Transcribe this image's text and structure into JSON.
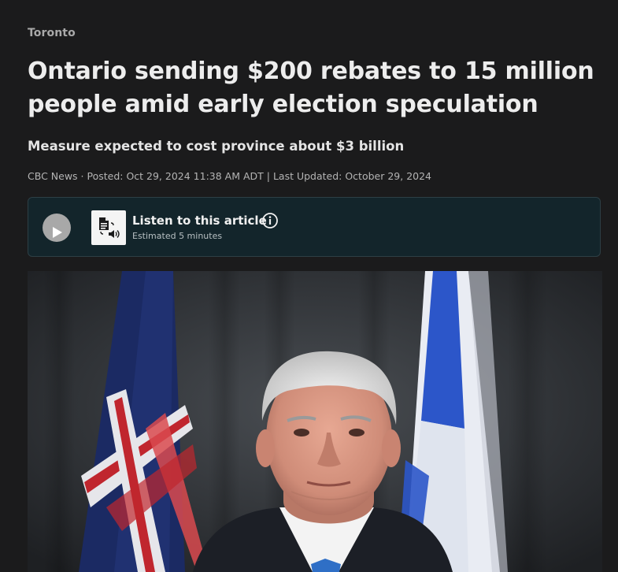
{
  "section": {
    "label": "Toronto"
  },
  "article": {
    "headline": "Ontario sending $200 rebates to 15 million people amid early election speculation",
    "deck": "Measure expected to cost province about $3 billion",
    "byline": "CBC News · Posted: Oct 29, 2024 11:38 AM ADT | Last Updated: October 29, 2024"
  },
  "audio": {
    "title": "Listen to this article",
    "subtitle": "Estimated 5 minutes",
    "play_icon": "play-icon",
    "thumb_icons": [
      "document-icon",
      "speaker-icon"
    ],
    "info_icon": "info-icon"
  },
  "photo": {
    "subject": "man-in-suit-with-flags"
  },
  "colors": {
    "background": "#1b1b1c",
    "audio_panel": "#13252b",
    "headline": "#ededed",
    "section": "#a9a9a9"
  }
}
